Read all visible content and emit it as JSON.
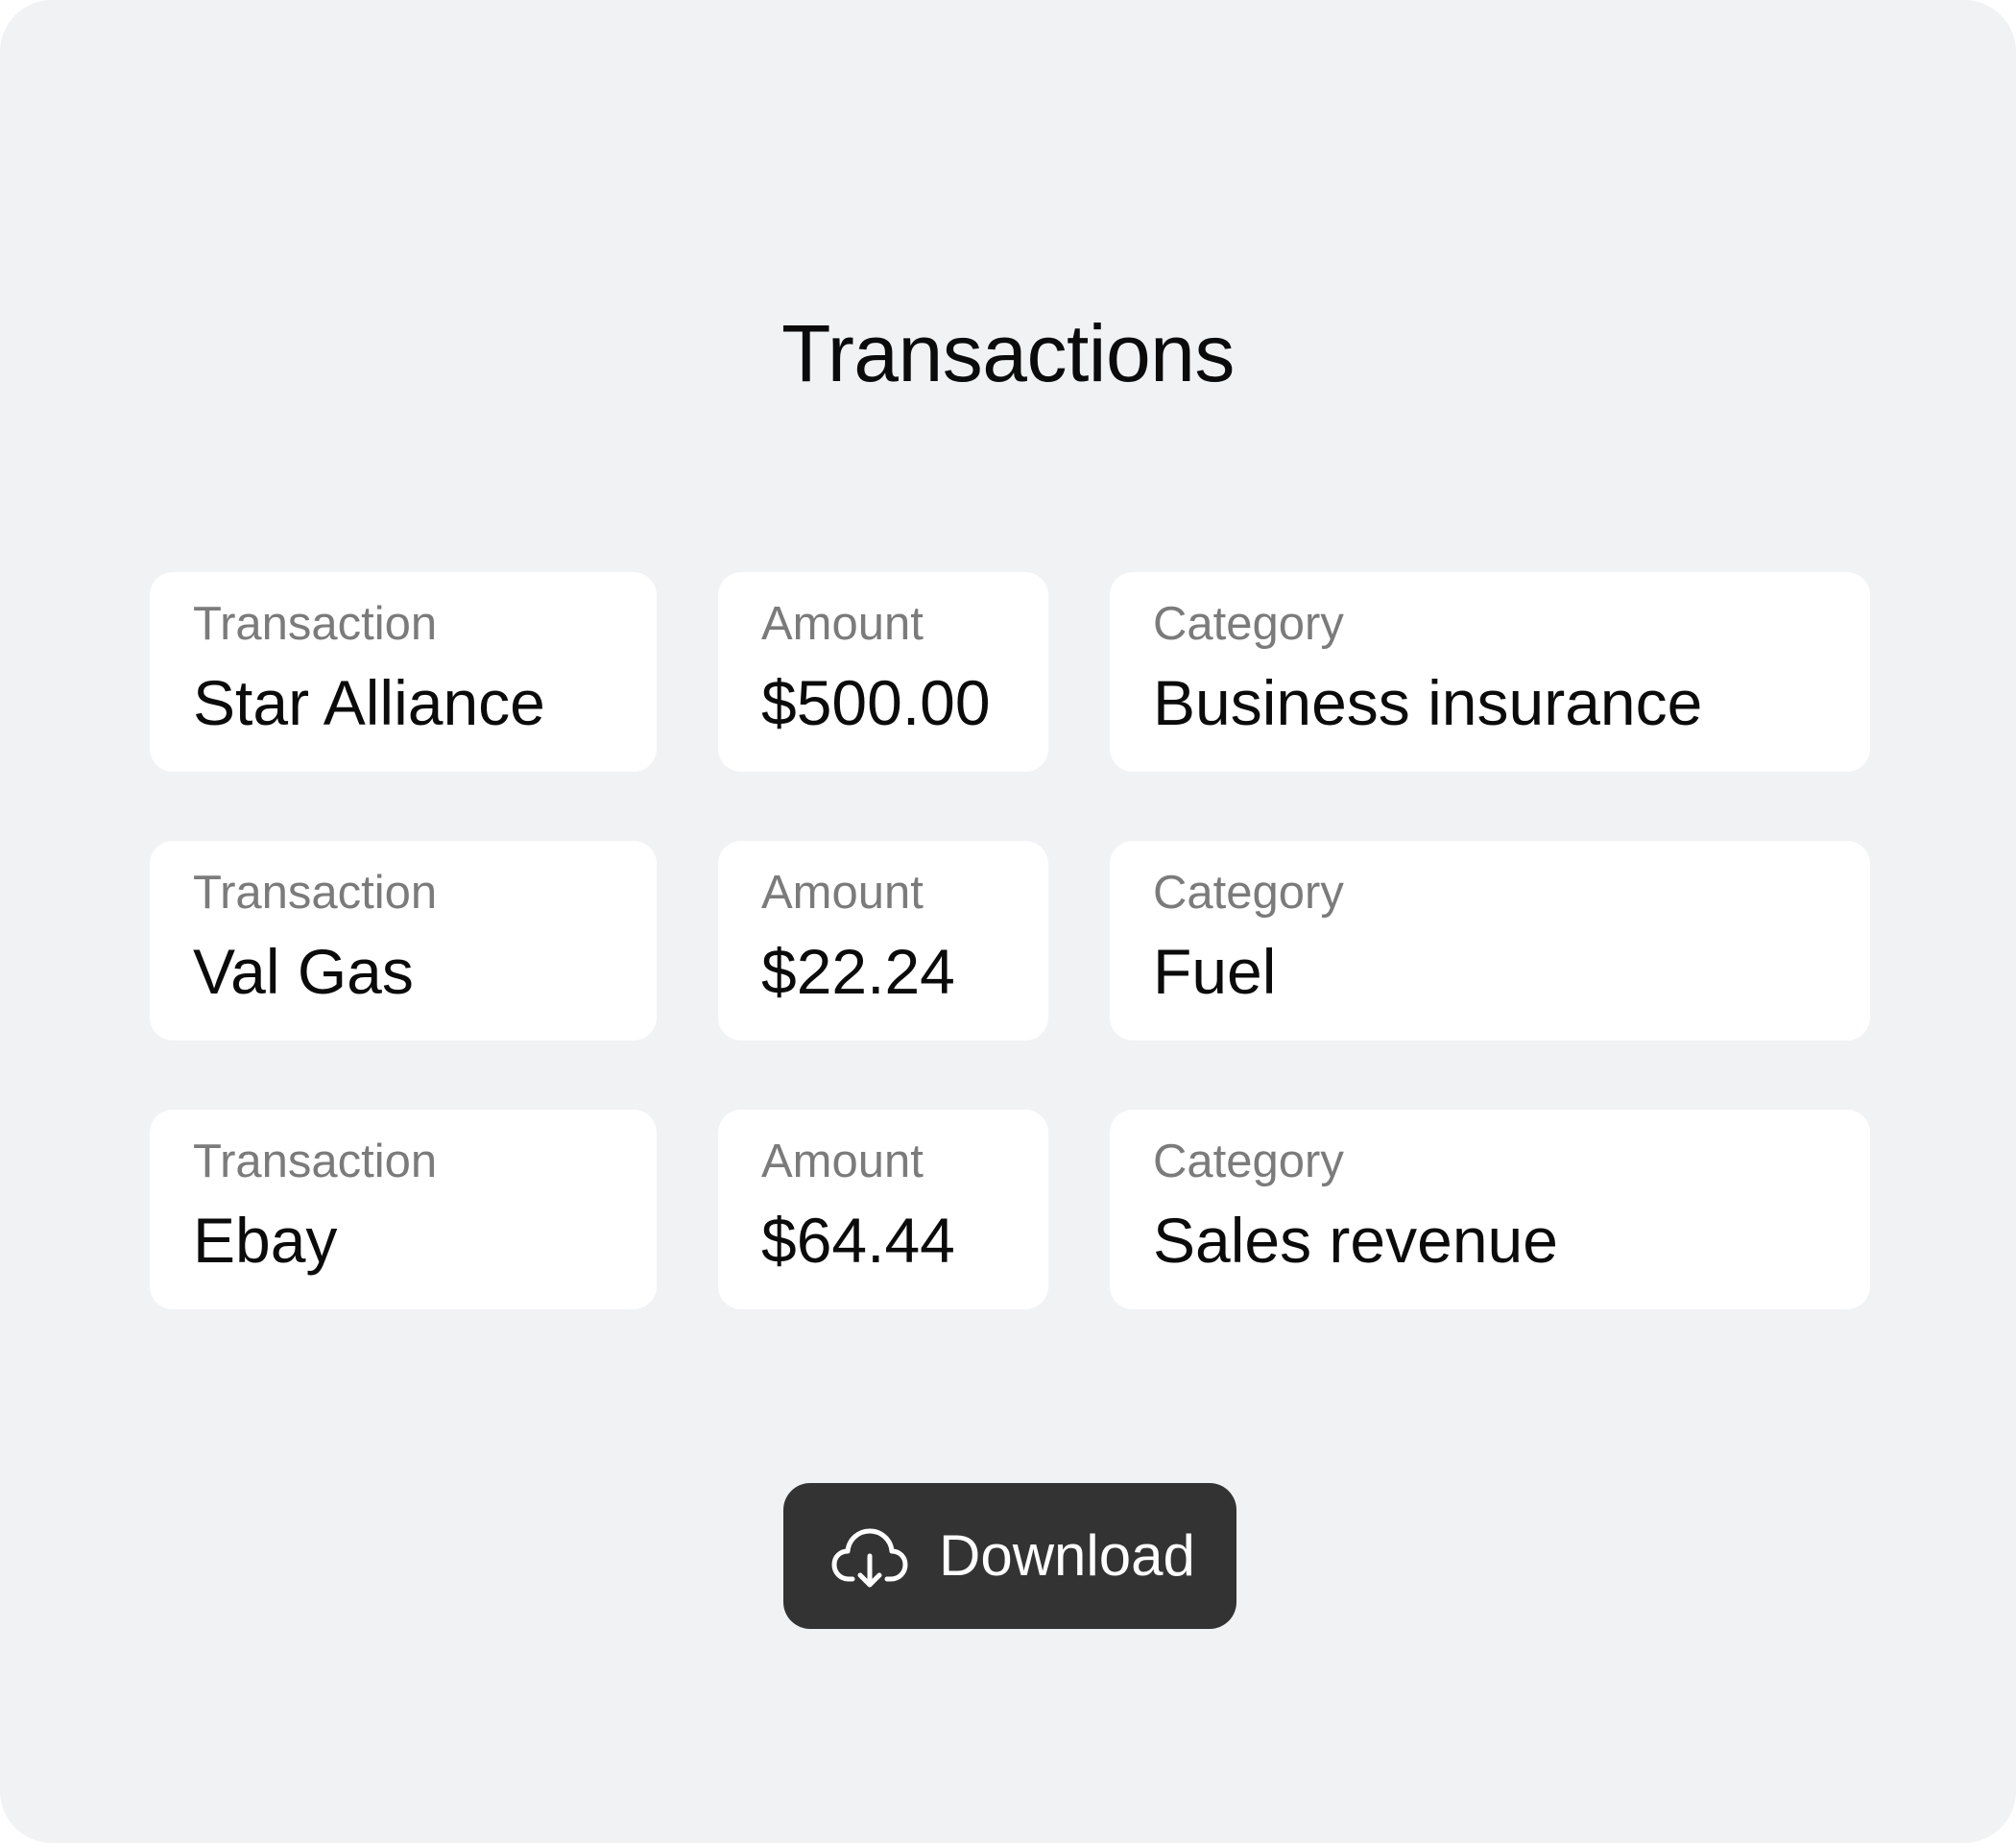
{
  "page": {
    "title": "Transactions"
  },
  "rows": [
    {
      "transaction_label": "Transaction",
      "transaction": "Star Alliance",
      "amount_label": "Amount",
      "amount": "$500.00",
      "category_label": "Category",
      "category": "Business insurance"
    },
    {
      "transaction_label": "Transaction",
      "transaction": "Val Gas",
      "amount_label": "Amount",
      "amount": "$22.24",
      "category_label": "Category",
      "category": "Fuel"
    },
    {
      "transaction_label": "Transaction",
      "transaction": "Ebay",
      "amount_label": "Amount",
      "amount": "$64.44",
      "category_label": "Category",
      "category": "Sales revenue"
    }
  ],
  "download": {
    "label": "Download",
    "icon": "cloud-download-icon"
  },
  "colors": {
    "background": "#f1f2f4",
    "card": "#ffffff",
    "button": "#333333",
    "label_text": "#7b7b7b",
    "value_text": "#0b0b0b"
  }
}
